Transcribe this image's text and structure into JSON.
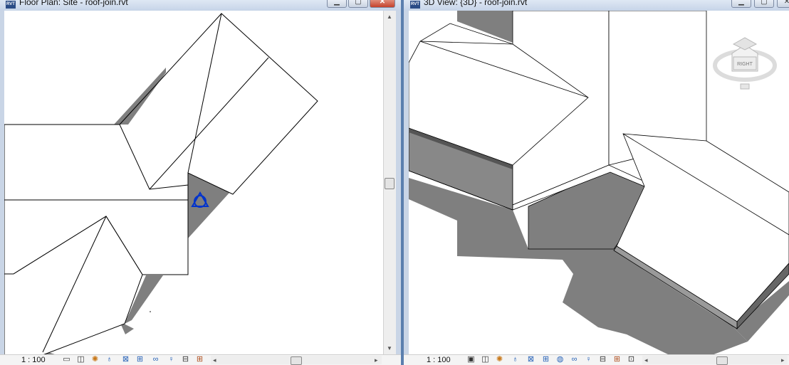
{
  "left_view": {
    "title": "Floor Plan: Site - roof-join.rvt",
    "app_badge": "RVT",
    "scale": "1 : 100",
    "status_icons": [
      "plan-region-icon",
      "view-cube-icon",
      "sun-path-icon",
      "shadows-icon",
      "crop-region-icon",
      "show-crop-icon",
      "temporary-hide-icon",
      "reveal-hidden-icon",
      "lock-3d-icon",
      "worksharing-icon"
    ]
  },
  "right_view": {
    "title": "3D View: {3D} - roof-join.rvt",
    "app_badge": "RVT",
    "scale": "1 : 100",
    "viewcube_face": "RIGHT",
    "status_icons": [
      "visual-style-icon",
      "view-cube-icon",
      "sun-path-icon",
      "shadows-icon",
      "render-icon",
      "crop-region-icon",
      "show-crop-icon",
      "temporary-hide-icon",
      "reveal-hidden-icon",
      "lock-3d-icon",
      "worksharing-icon",
      "analysis-icon"
    ]
  },
  "window_buttons": {
    "minimize": "▁",
    "maximize": "▢",
    "close": "✕"
  },
  "colors": {
    "shadow": "#7f7f7f",
    "roof_fill": "#ffffff",
    "roof_line": "#000000",
    "title_bg": "#c9d5e6",
    "survey_point": "#0033cc"
  }
}
